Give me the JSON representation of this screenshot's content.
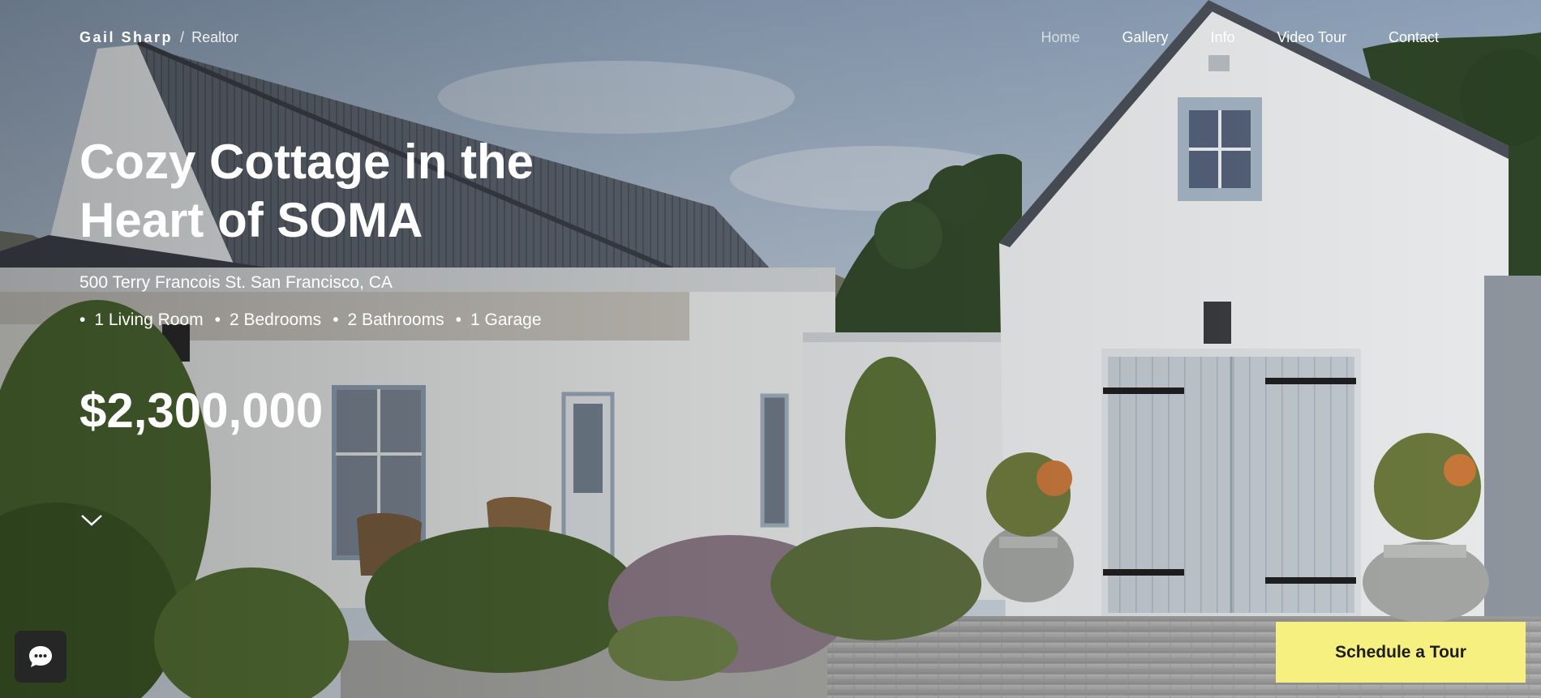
{
  "brand": {
    "name": "Gail Sharp",
    "separator": "/",
    "role": "Realtor"
  },
  "nav": {
    "items": [
      {
        "label": "Home",
        "active": true
      },
      {
        "label": "Gallery",
        "active": false
      },
      {
        "label": "Info",
        "active": false
      },
      {
        "label": "Video Tour",
        "active": false
      },
      {
        "label": "Contact",
        "active": false
      }
    ]
  },
  "listing": {
    "title_line1": "Cozy Cottage in the",
    "title_line2": "Heart of SOMA",
    "address": "500 Terry Francois St. San Francisco, CA",
    "features": [
      "1 Living Room",
      "2 Bedrooms",
      "2 Bathrooms",
      "1 Garage"
    ],
    "price": "$2,300,000"
  },
  "icons": {
    "scroll": "chevron-down-icon",
    "chat": "chat-bubble-icon"
  },
  "cta": {
    "label": "Schedule a Tour",
    "color": "#f6f081"
  },
  "colors": {
    "text": "#ffffff",
    "chat_bg": "#262626",
    "nav_active": "#d7dde4"
  }
}
